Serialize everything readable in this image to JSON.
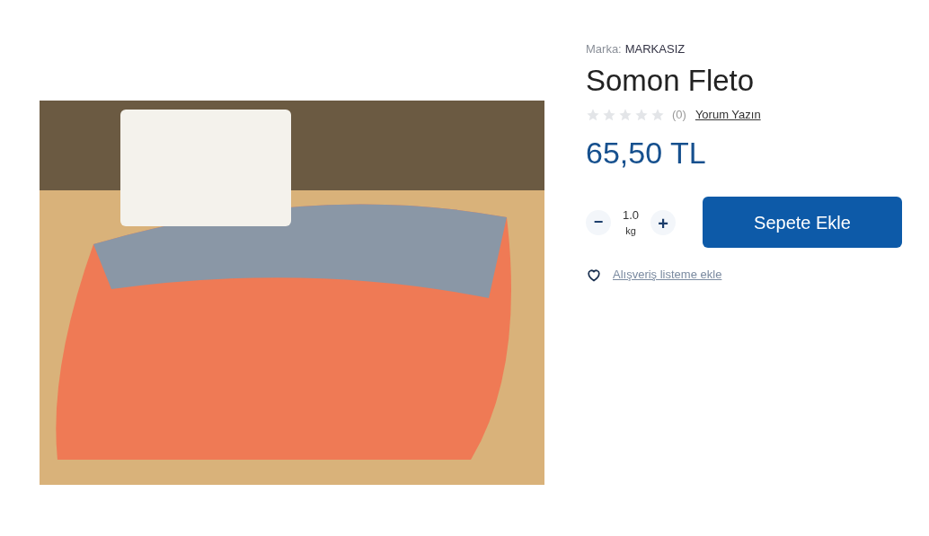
{
  "product": {
    "brand_label": "Marka:",
    "brand": "MARKASIZ",
    "title": "Somon Fleto",
    "stars": 0,
    "review_count": "(0)",
    "review_link": "Yorum Yazın",
    "price": "65,50 TL"
  },
  "quantity": {
    "minus": "−",
    "value": "1.0",
    "unit": "kg",
    "plus": "+"
  },
  "add_to_cart": "Sepete Ekle",
  "wishlist": "Alışveriş listeme ekle"
}
